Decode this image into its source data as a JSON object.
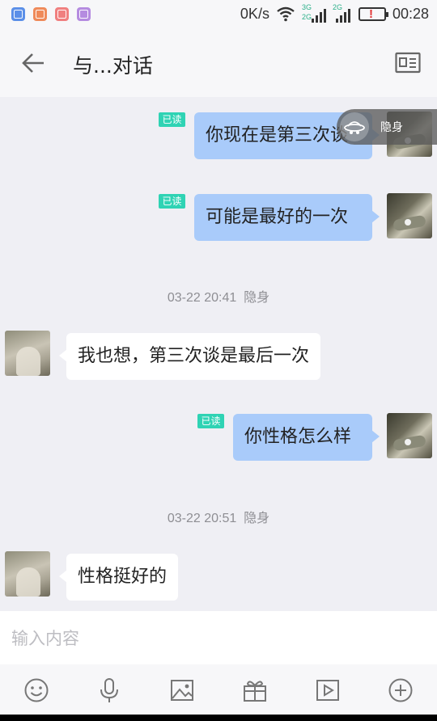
{
  "status_bar": {
    "speed": "0K/s",
    "net_top": "3G",
    "net_bottom": "2G",
    "net_alt": "2G",
    "time": "00:28",
    "app_icons": [
      {
        "name": "shield-app-icon",
        "color": "#5b8fe8"
      },
      {
        "name": "mail-app-icon",
        "color": "#ef8a5a"
      },
      {
        "name": "phone-app-icon",
        "color": "#f07f7f"
      },
      {
        "name": "gallery-app-icon",
        "color": "#b58be0"
      }
    ]
  },
  "header": {
    "title": "与...对话",
    "back_icon": "arrow-left-icon",
    "card_icon": "profile-card-icon"
  },
  "invisible_badge": "隐身",
  "read_label": "已读",
  "messages": [
    {
      "direction": "out",
      "text": "你现在是第三次谈",
      "read": "已读"
    },
    {
      "direction": "out",
      "text": "可能是最好的一次",
      "read": "已读"
    },
    {
      "direction": "time",
      "time": "03-22 20:41",
      "status": "隐身"
    },
    {
      "direction": "in",
      "text": "我也想，第三次谈是最后一次"
    },
    {
      "direction": "out",
      "text": "你性格怎么样",
      "read": "已读"
    },
    {
      "direction": "time",
      "time": "03-22 20:51",
      "status": "隐身"
    },
    {
      "direction": "in",
      "text": "性格挺好的"
    }
  ],
  "input": {
    "placeholder": "输入内容",
    "value": ""
  },
  "toolbar": {
    "icons": [
      "emoji-icon",
      "microphone-icon",
      "image-icon",
      "gift-icon",
      "video-icon",
      "plus-icon"
    ]
  },
  "colors": {
    "outgoing_bubble": "#a9cbfa",
    "incoming_bubble": "#ffffff",
    "read_badge": "#2fd3b4",
    "chat_background": "#efeff4"
  }
}
